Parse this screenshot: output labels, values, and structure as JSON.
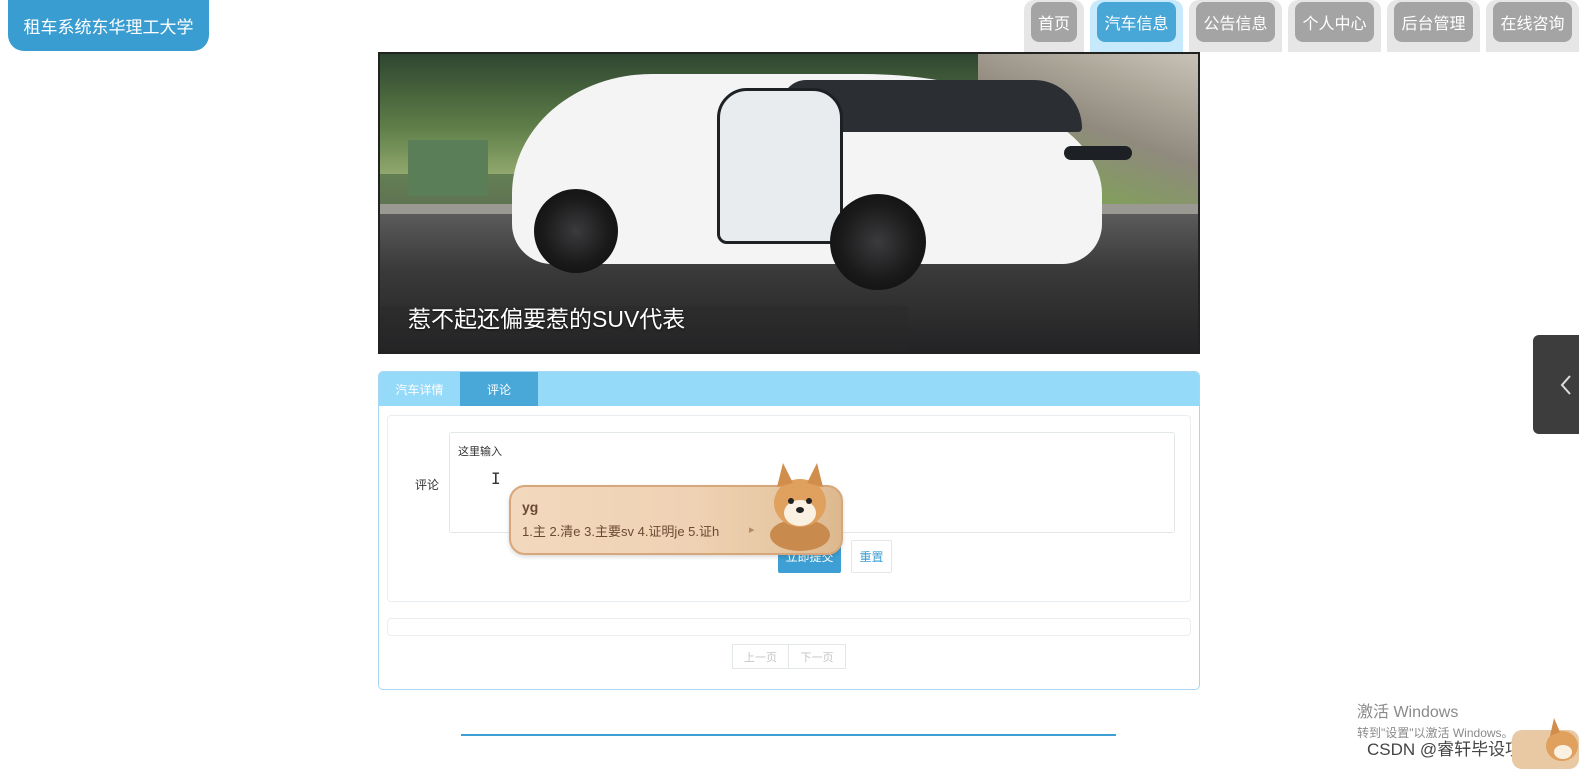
{
  "site": {
    "logo_text": "租车系统东华理工大学"
  },
  "nav": {
    "items": [
      {
        "label": "首页",
        "active": false
      },
      {
        "label": "汽车信息",
        "active": true
      },
      {
        "label": "公告信息",
        "active": false
      },
      {
        "label": "个人中心",
        "active": false
      },
      {
        "label": "后台管理",
        "active": false
      },
      {
        "label": "在线咨询",
        "active": false
      }
    ]
  },
  "banner": {
    "caption": "惹不起还偏要惹的SUV代表"
  },
  "tabs": [
    {
      "label": "汽车详情",
      "active": false
    },
    {
      "label": "评论",
      "active": true
    }
  ],
  "comment_form": {
    "label": "评论",
    "value": "这里输入",
    "submit_label": "立即提交",
    "reset_label": "重置"
  },
  "pagination": {
    "prev_label": "上一页",
    "next_label": "下一页"
  },
  "ime": {
    "input": "yg",
    "candidates": "1.主  2.清e  3.主要sv  4.证明je  5.证h"
  },
  "watermark": {
    "activate_title": "激活 Windows",
    "activate_sub": "转到\"设置\"以激活 Windows。",
    "csdn": "CSDN @睿轩毕设项目"
  },
  "colors": {
    "accent": "#3d9fd3",
    "tab_bar": "#95daf8",
    "nav_inactive": "#a4a4a4"
  }
}
